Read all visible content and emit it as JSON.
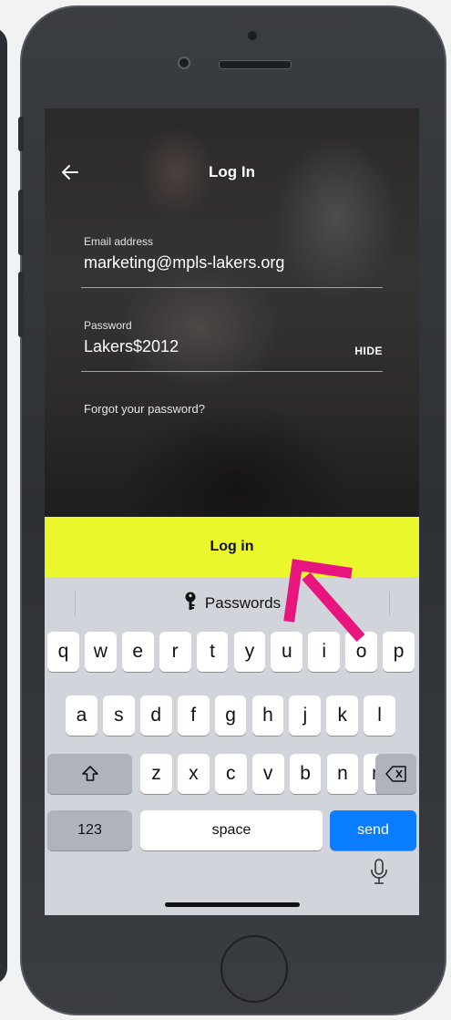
{
  "screen": {
    "title": "Log In",
    "email": {
      "label": "Email address",
      "value": "marketing@mpls-lakers.org"
    },
    "password": {
      "label": "Password",
      "value": "Lakers$2012",
      "toggle": "HIDE"
    },
    "forgot": "Forgot your password?",
    "login_button": "Log in"
  },
  "keyboard": {
    "suggestion": "Passwords",
    "row1": [
      "q",
      "w",
      "e",
      "r",
      "t",
      "y",
      "u",
      "i",
      "o",
      "p"
    ],
    "row2": [
      "a",
      "s",
      "d",
      "f",
      "g",
      "h",
      "j",
      "k",
      "l"
    ],
    "row3": [
      "z",
      "x",
      "c",
      "v",
      "b",
      "n",
      "m"
    ],
    "numbers_key": "123",
    "space_key": "space",
    "send_key": "send"
  },
  "colors": {
    "login_button": "#eaf72d",
    "send_key": "#0a7cff",
    "annotation_arrow": "#e8157f"
  },
  "icons": [
    "back-arrow-icon",
    "key-icon",
    "shift-icon",
    "backspace-icon",
    "microphone-icon"
  ]
}
